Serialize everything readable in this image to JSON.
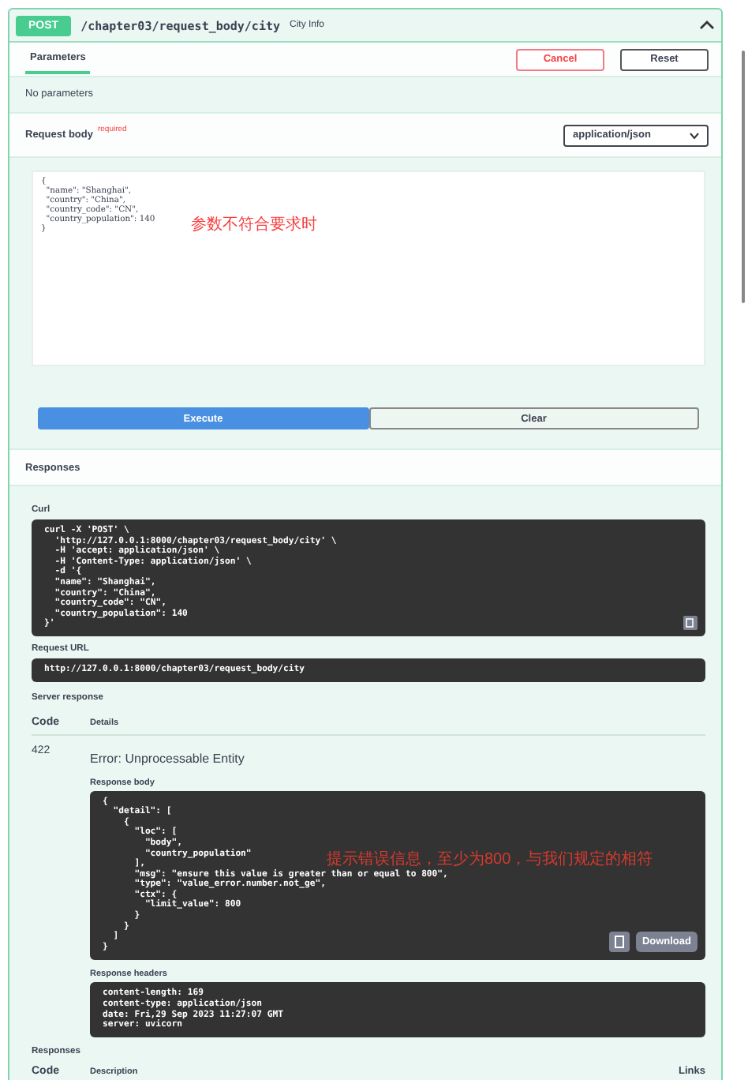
{
  "operation": {
    "method": "POST",
    "path": "/chapter03/request_body/city",
    "summary": "City Info",
    "expanded": true
  },
  "tabs": [
    {
      "label": "Parameters",
      "selected": true
    }
  ],
  "actions": [
    {
      "label": "Cancel",
      "kind": "cancel"
    },
    {
      "label": "Reset",
      "kind": "reset"
    }
  ],
  "parameters_note": "No parameters",
  "request_body": {
    "label": "Request body",
    "required": "required",
    "content_type": "application/json",
    "lines": [
      "{",
      "  \"name\": \"Shanghai\",",
      "  \"country\": \"China\",",
      "  \"country_code\": \"CN\",",
      "  \"country_population\": 140",
      "}"
    ],
    "annotation": "参数不符合要求时"
  },
  "execute_buttons": [
    {
      "label": "Execute",
      "kind": "primary"
    },
    {
      "label": "Clear",
      "kind": "secondary"
    }
  ],
  "responses_title": "Responses",
  "curl": {
    "label": "Curl",
    "lines": [
      "curl -X 'POST' \\",
      "  'http://127.0.0.1:8000/chapter03/request_body/city' \\",
      "  -H 'accept: application/json' \\",
      "  -H 'Content-Type: application/json' \\",
      "  -d '{",
      "  \"name\": \"Shanghai\",",
      "  \"country\": \"China\",",
      "  \"country_code\": \"CN\",",
      "  \"country_population\": 140",
      "}'"
    ]
  },
  "request_url": {
    "label": "Request URL",
    "value": "http://127.0.0.1:8000/chapter03/request_body/city"
  },
  "server_response": {
    "label": "Server response",
    "columns": [
      "Code",
      "Details"
    ],
    "code": "422",
    "error": "Error: Unprocessable Entity",
    "body_label": "Response body",
    "body_lines": [
      "{",
      "  \"detail\": [",
      "    {",
      "      \"loc\": [",
      "        \"body\",",
      "        \"country_population\"",
      "      ],",
      "      \"msg\": \"ensure this value is greater than or equal to 800\",",
      "      \"type\": \"value_error.number.not_ge\",",
      "      \"ctx\": {",
      "        \"limit_value\": 800",
      "      }",
      "    }",
      "  ]",
      "}"
    ],
    "annotation": "提示错误信息，至少为800，与我们规定的相符",
    "download": "Download",
    "headers_label": "Response headers",
    "headers_lines": [
      "content-length: 169",
      "content-type: application/json",
      "date: Fri,29 Sep 2023 11:27:07 GMT",
      "server: uvicorn"
    ]
  },
  "responses": {
    "label": "Responses",
    "columns": [
      "Code",
      "Description",
      "Links"
    ]
  }
}
